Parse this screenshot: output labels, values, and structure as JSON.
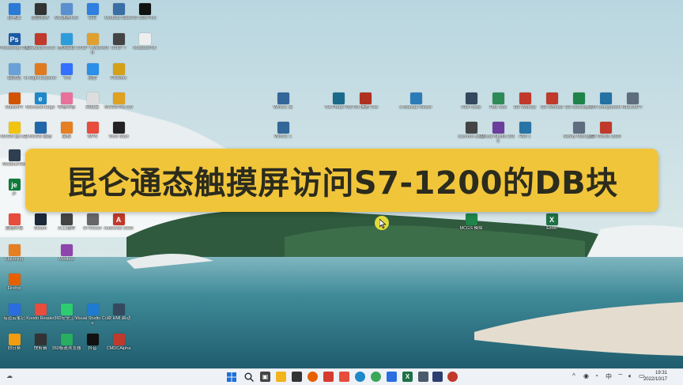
{
  "banner": {
    "title": "昆仑通态触摸屏访问S7-1200的DB块"
  },
  "desktop_icons": [
    {
      "label": "此电脑",
      "color": "#2a7ad6",
      "glyph": ""
    },
    {
      "label": "魔兽世界",
      "color": "#333",
      "glyph": ""
    },
    {
      "label": "MC通信Tool",
      "color": "#5a8fd0",
      "glyph": ""
    },
    {
      "label": "钉钉",
      "color": "#2f7fe0",
      "glyph": ""
    },
    {
      "label": "Modbus Slave",
      "color": "#3a6ea5",
      "glyph": ""
    },
    {
      "label": "S7-200 PLC",
      "color": "#111",
      "glyph": ""
    },
    {
      "label": "Photoshop CS6",
      "color": "#1b5aa8",
      "glyph": "Ps"
    },
    {
      "label": "NetAssist 5.0.3",
      "color": "#c0392b",
      "glyph": ""
    },
    {
      "label": "腾讯会议",
      "color": "#2d9cdb",
      "glyph": ""
    },
    {
      "label": "STEP 7-MicroWIN",
      "color": "#e0a030",
      "glyph": ""
    },
    {
      "label": "STEP 7",
      "color": "#444",
      "glyph": ""
    },
    {
      "label": "ModbusPoll",
      "color": "#eee",
      "glyph": ""
    },
    {
      "label": "回收站",
      "color": "#6aa0d8",
      "glyph": ""
    },
    {
      "label": "In-Sight Explorer",
      "color": "#e07a1f",
      "glyph": ""
    },
    {
      "label": "飞书",
      "color": "#3370ff",
      "glyph": ""
    },
    {
      "label": "迅雷",
      "color": "#2a8fe8",
      "glyph": ""
    },
    {
      "label": "PCWorx",
      "color": "#d4a017",
      "glyph": ""
    },
    {
      "label": "MasterPr",
      "color": "#d35400",
      "glyph": ""
    },
    {
      "label": "Microsoft Edge",
      "color": "#1e88c8",
      "glyph": "e"
    },
    {
      "label": "哔哩哔哩",
      "color": "#e7719a",
      "glyph": ""
    },
    {
      "label": "网易云",
      "color": "#ddd",
      "glyph": ""
    },
    {
      "label": "MCGS Pro 5.0",
      "color": "#e0a020",
      "glyph": ""
    },
    {
      "label": "MCGS 嵌入版",
      "color": "#f1c40f",
      "glyph": ""
    },
    {
      "label": "MCGS 组态",
      "color": "#2266aa",
      "glyph": ""
    },
    {
      "label": "金蝶",
      "color": "#e67e22",
      "glyph": ""
    },
    {
      "label": "WPS",
      "color": "#e74c3c",
      "glyph": ""
    },
    {
      "label": "Time Start",
      "color": "#222",
      "glyph": ""
    },
    {
      "label": "ModbusTest",
      "color": "#2c3e50",
      "glyph": ""
    },
    {
      "label": "je",
      "color": "#117a3a",
      "glyph": "je"
    },
    {
      "label": "直播伴侣",
      "color": "#e74c3c",
      "glyph": ""
    },
    {
      "label": "Steam",
      "color": "#1b2838",
      "glyph": ""
    },
    {
      "label": "大工程师",
      "color": "#444",
      "glyph": ""
    },
    {
      "label": "STViewer",
      "color": "#666",
      "glyph": ""
    },
    {
      "label": "AutoCAD 2016",
      "color": "#c0392b",
      "glyph": "A"
    },
    {
      "label": "Lightning",
      "color": "#e67e22",
      "glyph": ""
    },
    {
      "label": "Modbus",
      "color": "#8e44ad",
      "glyph": ""
    },
    {
      "label": "Firefox",
      "color": "#e66000",
      "glyph": ""
    },
    {
      "label": "有道云笔记",
      "color": "#2a6de0",
      "glyph": ""
    },
    {
      "label": "Koodo Reader",
      "color": "#e74c3c",
      "glyph": ""
    },
    {
      "label": "360安全卫士",
      "color": "#2ecc71",
      "glyph": ""
    },
    {
      "label": "Visual Studio Code",
      "color": "#1f7ad1",
      "glyph": ""
    },
    {
      "label": "32 HMI 启动",
      "color": "#34495e",
      "glyph": ""
    },
    {
      "label": "向日葵",
      "color": "#f39c12",
      "glyph": ""
    },
    {
      "label": "快剪辑",
      "color": "#333",
      "glyph": ""
    },
    {
      "label": "360极速浏览器",
      "color": "#27ae60",
      "glyph": ""
    },
    {
      "label": "抖音",
      "color": "#111",
      "glyph": ""
    },
    {
      "label": "CMDCAlpha",
      "color": "#c0392b",
      "glyph": ""
    },
    {
      "label": "WinCC 灵",
      "color": "#336699",
      "glyph": ""
    },
    {
      "label": "TIA Portal V16",
      "color": "#1a6a8a",
      "glyph": ""
    },
    {
      "label": "TIA 博途 V14",
      "color": "#b03020",
      "glyph": ""
    },
    {
      "label": "e-Manual Viewer",
      "color": "#2b7bb9",
      "glyph": ""
    },
    {
      "label": "ROI-Tools",
      "color": "#34495e",
      "glyph": ""
    },
    {
      "label": "FBs Tool",
      "color": "#2e8b57",
      "glyph": ""
    },
    {
      "label": "GX Works2",
      "color": "#c0392b",
      "glyph": ""
    },
    {
      "label": "GX Works3",
      "color": "#c0392b",
      "glyph": ""
    },
    {
      "label": "GX Developer",
      "color": "#1e8449",
      "glyph": ""
    },
    {
      "label": "MX Component",
      "color": "#2471a3",
      "glyph": ""
    },
    {
      "label": "MELSOFT",
      "color": "#5d6d7e",
      "glyph": ""
    },
    {
      "label": "WinCC 1",
      "color": "#336699",
      "glyph": ""
    },
    {
      "label": "sacomm 桌面",
      "color": "#444",
      "glyph": ""
    },
    {
      "label": "Visual Studio 2019",
      "color": "#6c3d9c",
      "glyph": ""
    },
    {
      "label": "HMI 1",
      "color": "#2874a6",
      "glyph": ""
    },
    {
      "label": "Safety Manager",
      "color": "#5d6d7e",
      "glyph": ""
    },
    {
      "label": "GX Works 2020",
      "color": "#c0392b",
      "glyph": ""
    },
    {
      "label": "MCGS 模拟",
      "color": "#1e8449",
      "glyph": ""
    },
    {
      "label": "Excel",
      "color": "#1e7145",
      "glyph": "X"
    }
  ],
  "taskbar": {
    "time": "19:31",
    "date": "2022/10/17"
  }
}
